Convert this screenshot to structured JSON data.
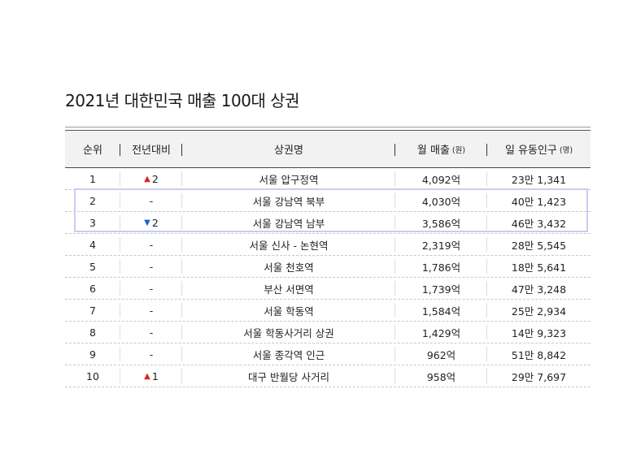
{
  "title": "2021년 대한민국 매출 100대 상권",
  "headers": {
    "rank": "순위",
    "change": "전년대비",
    "name": "상권명",
    "sales": "월 매출",
    "sales_unit": "(원)",
    "population": "일 유동인구",
    "population_unit": "(명)"
  },
  "rows": [
    {
      "rank": "1",
      "dir": "up",
      "change": "2",
      "name": "서울 압구정역",
      "sales": "4,092억",
      "population": "23만 1,341"
    },
    {
      "rank": "2",
      "dir": "",
      "change": "-",
      "name": "서울 강남역 북부",
      "sales": "4,030억",
      "population": "40만 1,423"
    },
    {
      "rank": "3",
      "dir": "down",
      "change": "2",
      "name": "서울 강남역 남부",
      "sales": "3,586억",
      "population": "46만 3,432"
    },
    {
      "rank": "4",
      "dir": "",
      "change": "-",
      "name": "서울 신사 - 논현역",
      "sales": "2,319억",
      "population": "28만 5,545"
    },
    {
      "rank": "5",
      "dir": "",
      "change": "-",
      "name": "서울 천호역",
      "sales": "1,786억",
      "population": "18만 5,641"
    },
    {
      "rank": "6",
      "dir": "",
      "change": "-",
      "name": "부산 서면역",
      "sales": "1,739억",
      "population": "47만 3,248"
    },
    {
      "rank": "7",
      "dir": "",
      "change": "-",
      "name": "서울 학동역",
      "sales": "1,584억",
      "population": "25만 2,934"
    },
    {
      "rank": "8",
      "dir": "",
      "change": "-",
      "name": "서울 학동사거리 상권",
      "sales": "1,429억",
      "population": "14만 9,323"
    },
    {
      "rank": "9",
      "dir": "",
      "change": "-",
      "name": "서울 종각역 인근",
      "sales": "962억",
      "population": "51만 8,842"
    },
    {
      "rank": "10",
      "dir": "up",
      "change": "1",
      "name": "대구 반월당 사거리",
      "sales": "958억",
      "population": "29만 7,697"
    }
  ],
  "arrows": {
    "up": "▲",
    "down": "▼"
  },
  "colors": {
    "up": "#e02020",
    "down": "#1f5fd8",
    "highlight": "#c9cdf3"
  }
}
